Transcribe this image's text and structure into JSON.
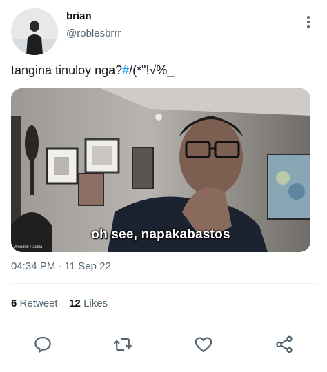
{
  "author": {
    "display_name": "brian",
    "handle": "@roblesbrrr",
    "avatar_icon": "profile-photo"
  },
  "tweet": {
    "text_before_link": "tangina tinuloy nga?",
    "hashtag": "#",
    "text_after_link": "/(*\"!√%_",
    "media": {
      "caption": "oh see, napakabastos",
      "credit": "Wendell Padilla"
    },
    "timestamp": "04:34 PM · 11 Sep 22"
  },
  "stats": {
    "retweets": {
      "count": "6",
      "label": "Retweet"
    },
    "likes": {
      "count": "12",
      "label": "Likes"
    }
  },
  "icons": {
    "more": "more-vertical-icon",
    "reply": "reply-icon",
    "retweet": "retweet-icon",
    "like": "heart-icon",
    "share": "share-icon"
  },
  "colors": {
    "link": "#1d9bf0",
    "secondary_text": "#536471",
    "divider": "#eff3f4"
  }
}
